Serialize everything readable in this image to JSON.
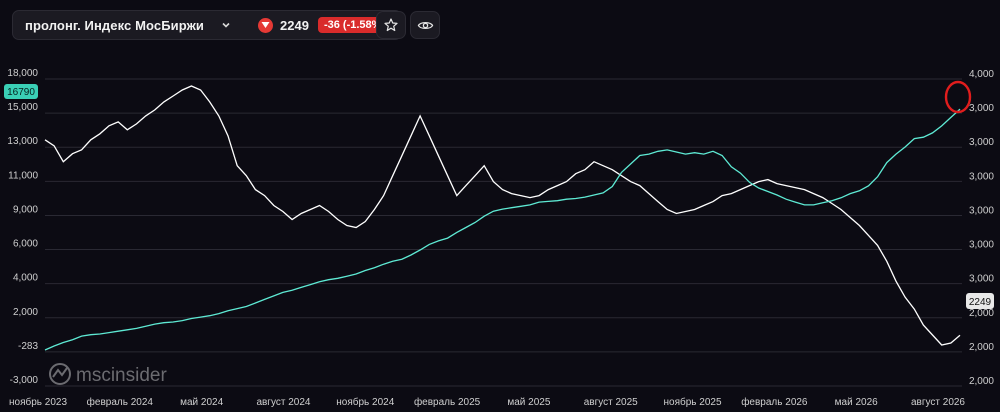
{
  "header": {
    "instrument_name": "пролонг. Индекс МосБиржи",
    "price": "2249",
    "change": "-36 (-1.58%)",
    "icons": [
      "chevron-down-icon",
      "down-triangle-icon",
      "star-icon",
      "eye-icon"
    ]
  },
  "watermark": {
    "text": "mscinsider"
  },
  "colors": {
    "background": "#0c0b13",
    "series_teal": "#5eead4",
    "series_white": "#ffffff",
    "down_red": "#e53935",
    "highlight_circle": "#e11d1d",
    "badge_teal": "#3ad0b6"
  },
  "chart_data": {
    "type": "line",
    "left_axis": {
      "ticks": [
        "18,000",
        "15,000",
        "13,000",
        "11,000",
        "9,000",
        "6,000",
        "4,000",
        "2,000",
        "-283",
        "-3,000"
      ],
      "current_value_badge": "16790"
    },
    "right_axis": {
      "ticks": [
        "4,000",
        "3,000",
        "3,000",
        "3,000",
        "3,000",
        "3,000",
        "3,000",
        "2,000",
        "2,000",
        "2,000"
      ],
      "current_value_badge": "2249"
    },
    "x_axis": {
      "labels": [
        "ноябрь 2023",
        "февраль 2024",
        "май 2024",
        "август 2024",
        "ноябрь 2024",
        "февраль 2025",
        "май 2025",
        "август 2025",
        "ноябрь 2025",
        "февраль 2026",
        "май 2026",
        "август 2026"
      ]
    },
    "grid": true,
    "series": [
      {
        "axis": "left",
        "color": "#5eead4",
        "values": [
          -283,
          0,
          250,
          450,
          700,
          800,
          850,
          950,
          1050,
          1150,
          1250,
          1400,
          1550,
          1650,
          1700,
          1800,
          1950,
          2050,
          2150,
          2300,
          2500,
          2650,
          2800,
          3050,
          3300,
          3550,
          3800,
          3950,
          4150,
          4350,
          4550,
          4700,
          4800,
          4950,
          5100,
          5350,
          5550,
          5800,
          6000,
          6150,
          6450,
          6800,
          7200,
          7450,
          7650,
          8050,
          8400,
          8750,
          9200,
          9550,
          9700,
          9800,
          9900,
          10000,
          10200,
          10250,
          10300,
          10400,
          10450,
          10550,
          10700,
          10850,
          11300,
          12300,
          12900,
          13500,
          13600,
          13800,
          13900,
          13750,
          13600,
          13700,
          13600,
          13800,
          13500,
          12700,
          12250,
          11600,
          11200,
          10950,
          10700,
          10400,
          10200,
          10000,
          10000,
          10150,
          10300,
          10500,
          10800,
          11000,
          11350,
          12000,
          13000,
          13600,
          14100,
          14700,
          14800,
          15100,
          15600,
          16200,
          16790
        ]
      },
      {
        "axis": "right",
        "color": "#ffffff",
        "values": [
          3230,
          3200,
          3120,
          3160,
          3180,
          3230,
          3260,
          3300,
          3320,
          3280,
          3310,
          3350,
          3380,
          3420,
          3450,
          3480,
          3500,
          3480,
          3420,
          3350,
          3250,
          3100,
          3050,
          2980,
          2950,
          2900,
          2870,
          2830,
          2860,
          2880,
          2900,
          2870,
          2830,
          2800,
          2790,
          2820,
          2880,
          2950,
          3050,
          3150,
          3250,
          3350,
          3250,
          3150,
          3050,
          2950,
          3000,
          3050,
          3100,
          3020,
          2980,
          2960,
          2950,
          2940,
          2950,
          2980,
          3000,
          3020,
          3060,
          3080,
          3120,
          3100,
          3080,
          3050,
          3020,
          3000,
          2960,
          2920,
          2880,
          2860,
          2870,
          2880,
          2900,
          2920,
          2950,
          2960,
          2980,
          3000,
          3020,
          3030,
          3010,
          3000,
          2990,
          2980,
          2960,
          2940,
          2910,
          2880,
          2840,
          2800,
          2750,
          2700,
          2620,
          2520,
          2440,
          2380,
          2300,
          2250,
          2200,
          2210,
          2249
        ]
      }
    ],
    "annotation": "red circle highlighting the latest peak on the teal series"
  }
}
